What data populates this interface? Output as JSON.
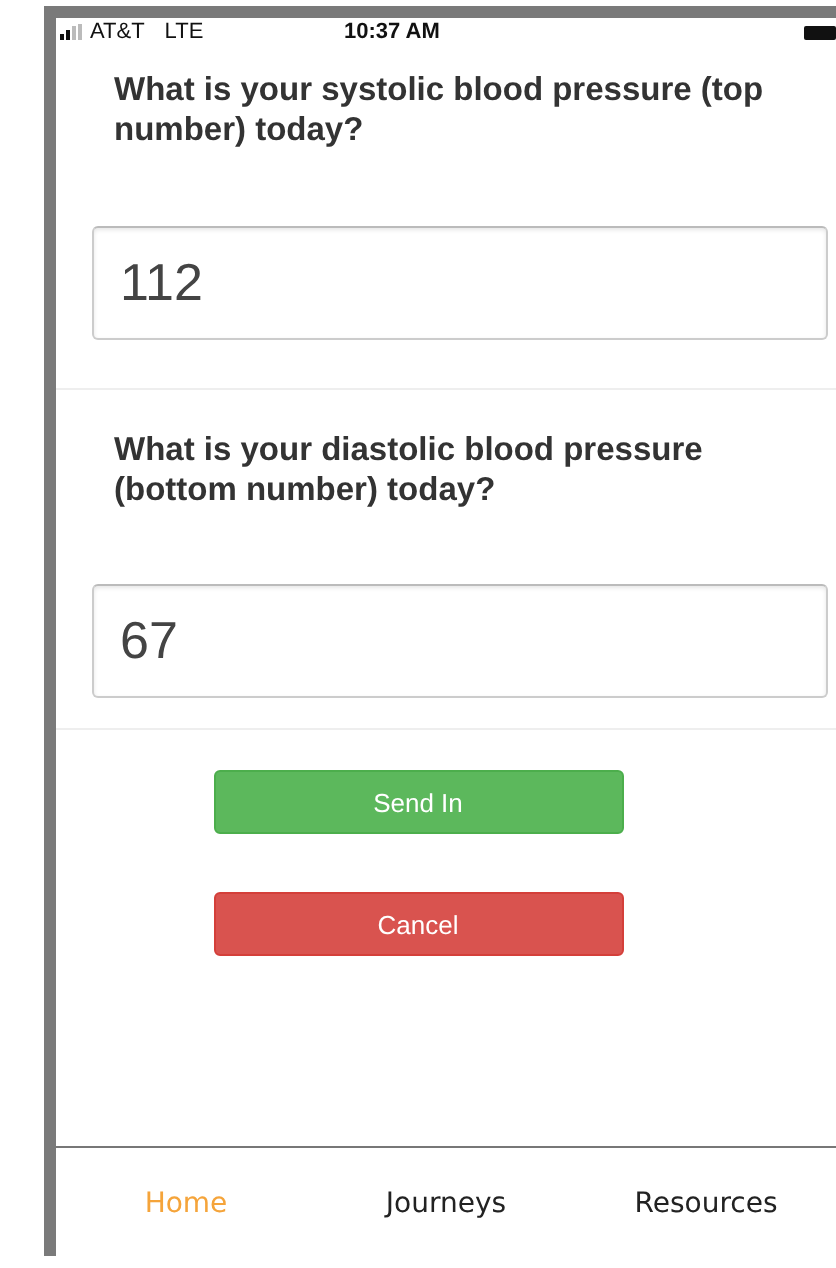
{
  "status_bar": {
    "carrier": "AT&T",
    "network": "LTE",
    "time": "10:37 AM"
  },
  "questions": [
    {
      "prompt": "What is your systolic blood pressure (top number) today?",
      "value": "112"
    },
    {
      "prompt": "What is your diastolic blood pressure (bottom number) today?",
      "value": "67"
    }
  ],
  "buttons": [
    {
      "label": "Send In",
      "kind": "primary"
    },
    {
      "label": "Cancel",
      "kind": "danger"
    }
  ],
  "tabs": [
    {
      "label": "Home",
      "selected": true
    },
    {
      "label": "Journeys",
      "selected": false
    },
    {
      "label": "Resources",
      "selected": false
    }
  ]
}
